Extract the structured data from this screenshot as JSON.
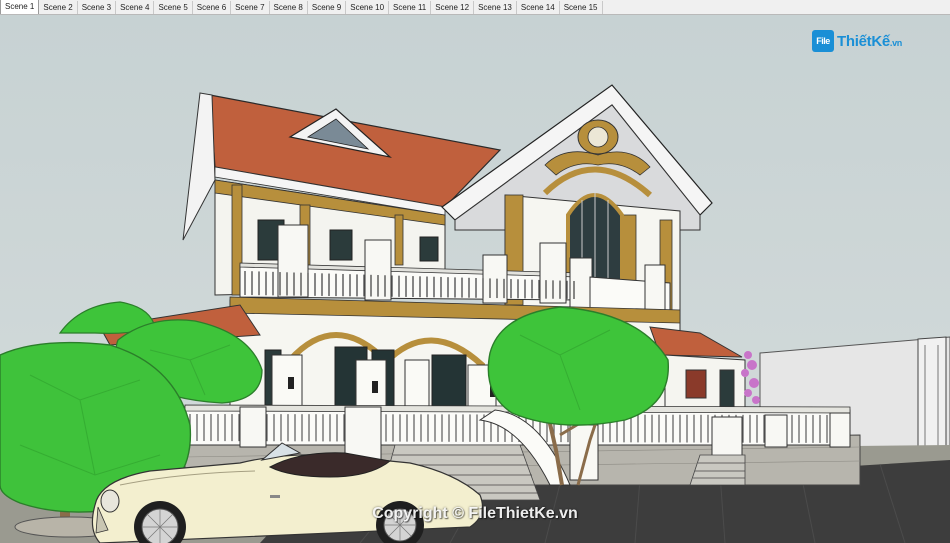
{
  "scene_tabs": [
    {
      "label": "Scene 1",
      "active": true
    },
    {
      "label": "Scene 2",
      "active": false
    },
    {
      "label": "Scene 3",
      "active": false
    },
    {
      "label": "Scene 4",
      "active": false
    },
    {
      "label": "Scene 5",
      "active": false
    },
    {
      "label": "Scene 6",
      "active": false
    },
    {
      "label": "Scene 7",
      "active": false
    },
    {
      "label": "Scene 8",
      "active": false
    },
    {
      "label": "Scene 9",
      "active": false
    },
    {
      "label": "Scene 10",
      "active": false
    },
    {
      "label": "Scene 11",
      "active": false
    },
    {
      "label": "Scene 12",
      "active": false
    },
    {
      "label": "Scene 13",
      "active": false
    },
    {
      "label": "Scene 14",
      "active": false
    },
    {
      "label": "Scene 15",
      "active": false
    }
  ],
  "logo": {
    "icon_text": "File",
    "brand": "ThiếtKế",
    "suffix": ".vn"
  },
  "watermark": "Copyright © FileThietKe.vn",
  "colors": {
    "sky": "#c9d3d4",
    "roof": "#c0603d",
    "trim_gold": "#b78f3c",
    "wall": "#f7f7f2",
    "tree": "#3ec43a",
    "car": "#f3efcf",
    "road": "#3f3f3f"
  }
}
